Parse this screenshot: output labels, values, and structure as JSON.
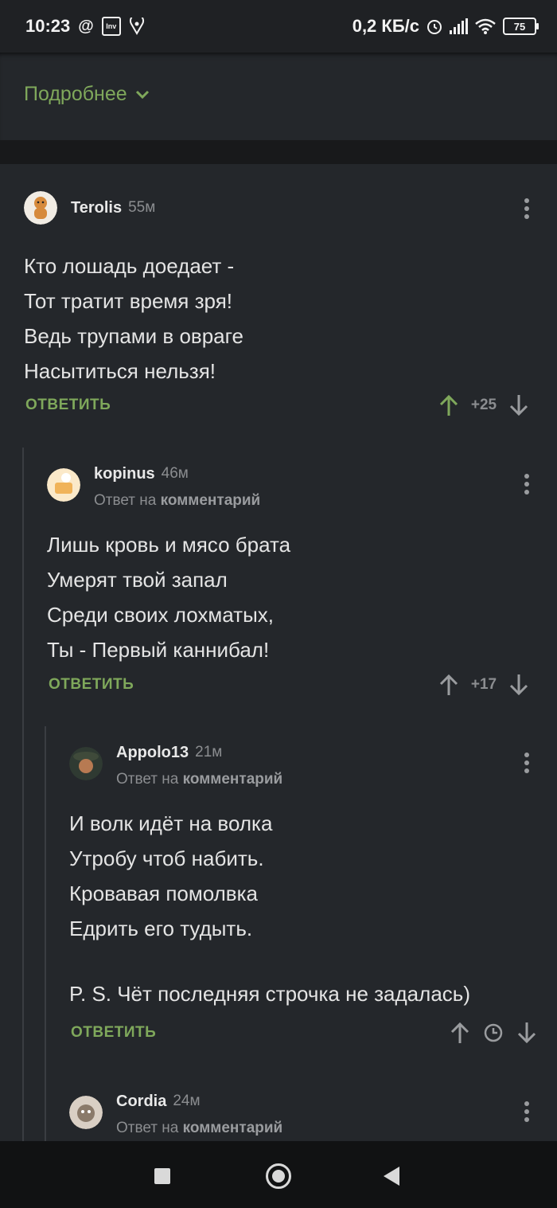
{
  "status_bar": {
    "time": "10:23",
    "net_speed": "0,2 КБ/с",
    "battery": "75",
    "icons": [
      "at-icon",
      "inv-icon",
      "location-icon",
      "alarm-icon",
      "signal-icon",
      "wifi-icon",
      "battery-icon"
    ]
  },
  "post": {
    "more_label": "Подробнее"
  },
  "comments": [
    {
      "username": "Terolis",
      "time": "55м",
      "lines": [
        "Кто лошадь доедает -",
        "Тот тратит время зря!",
        "Ведь трупами в овраге",
        "Насытиться нельзя!"
      ],
      "reply_label": "ОТВЕТИТЬ",
      "rating": "+25",
      "upvoted": true
    },
    {
      "username": "kopinus",
      "time": "46м",
      "reply_prefix": "Ответ на",
      "reply_target": "комментарий",
      "lines": [
        "Лишь кровь и мясо брата",
        "Умерят твой запал",
        "Среди своих лохматых,",
        "Ты - Первый каннибал!"
      ],
      "reply_label": "ОТВЕТИТЬ",
      "rating": "+17"
    },
    {
      "username": "Appolo13",
      "time": "21м",
      "reply_prefix": "Ответ на",
      "reply_target": "комментарий",
      "lines": [
        "И волк идёт на волка",
        "Утробу чтоб набить.",
        "Кровавая помолвка",
        "Едрить его тудыть.",
        "",
        "P. S. Чёт последняя строчка не задалась)"
      ],
      "reply_label": "ОТВЕТИТЬ",
      "rating_pending": true
    },
    {
      "username": "Cordia",
      "time": "24м",
      "reply_prefix": "Ответ на",
      "reply_target": "комментарий"
    }
  ],
  "colors": {
    "background": "#24272b",
    "accent_green": "#7fa85b",
    "muted": "#8b8d90"
  }
}
